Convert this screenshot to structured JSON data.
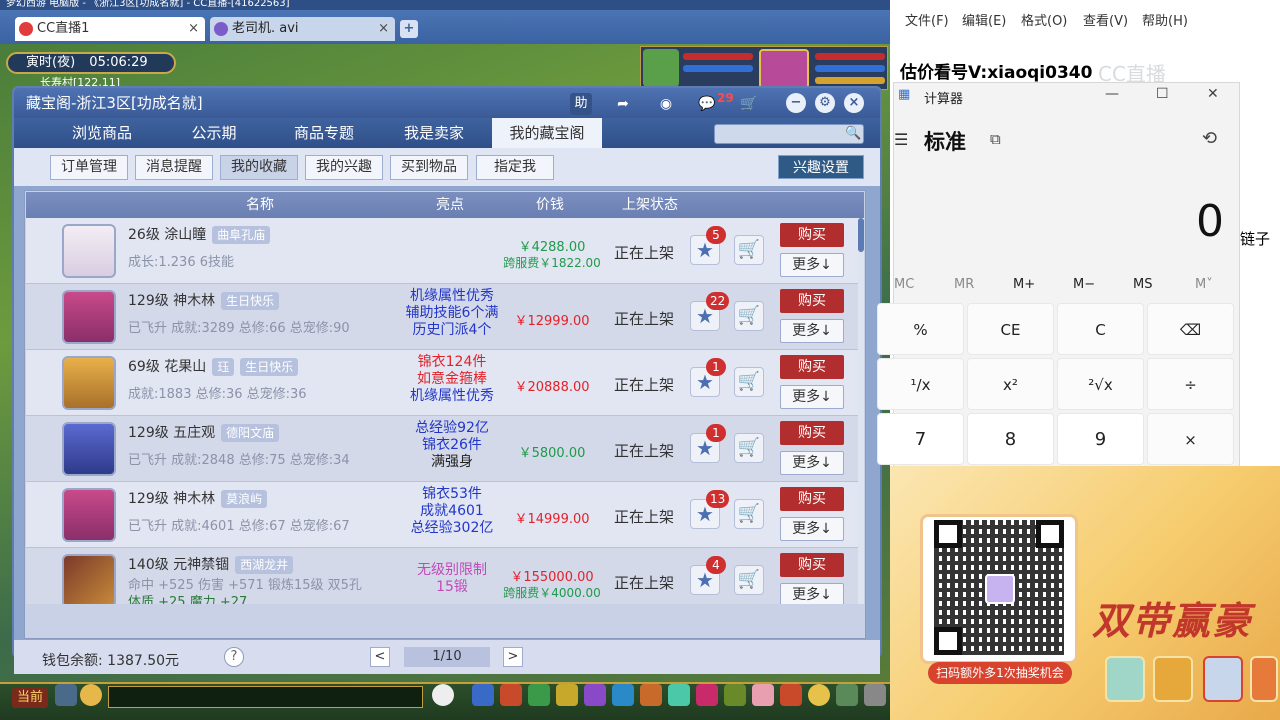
{
  "browser": {
    "top_text": "梦幻西游 电脑版 - 《浙江3区[功成名就] - CC直播-[41622563]",
    "tabs": [
      {
        "label": "CC直播1",
        "close": "×"
      },
      {
        "label": "老司机. avi",
        "close": "×"
      }
    ],
    "add_tab": "+"
  },
  "game": {
    "time_label": "寅时(夜)",
    "clock": "05:06:29",
    "location": "长寿村[122,11]"
  },
  "dialog": {
    "title": "藏宝阁-浙江3区[功成名就]",
    "help": "助",
    "message_count": "29",
    "nav_tabs": [
      "浏览商品",
      "公示期",
      "商品专题",
      "我是卖家",
      "我的藏宝阁"
    ],
    "sub_tabs": [
      "订单管理",
      "消息提醒",
      "我的收藏",
      "我的兴趣",
      "买到物品",
      "指定我"
    ],
    "interest_button": "兴趣设置",
    "columns": {
      "name": "名称",
      "highlight": "亮点",
      "price": "价钱",
      "status": "上架状态"
    },
    "rows": [
      {
        "level": "26级 涂山瞳",
        "server": "曲阜孔庙",
        "sub": "成长:1.236 6技能",
        "highlights": [],
        "price": "￥4288.00",
        "price2": "跨服费￥1822.00",
        "status": "正在上架",
        "fav": "5",
        "buy": "购买",
        "more": "更多↓"
      },
      {
        "level": "129级 神木林",
        "server": "生日快乐",
        "sub": "已飞升 成就:3289 总修:66 总宠修:90",
        "highlights": [
          "机缘属性优秀",
          "辅助技能6个满",
          "历史门派4个"
        ],
        "price": "￥12999.00",
        "price2": "",
        "status": "正在上架",
        "fav": "22",
        "buy": "购买",
        "more": "更多↓"
      },
      {
        "level": "69级 花果山",
        "tag": "珏",
        "server": "生日快乐",
        "sub": "成就:1883 总修:36 总宠修:36",
        "highlights": [
          "锦衣124件",
          "如意金箍棒",
          "机缘属性优秀"
        ],
        "price": "￥20888.00",
        "price2": "",
        "status": "正在上架",
        "fav": "1",
        "buy": "购买",
        "more": "更多↓"
      },
      {
        "level": "129级 五庄观",
        "server": "德阳文庙",
        "sub": "已飞升 成就:2848 总修:75 总宠修:34",
        "highlights": [
          "总经验92亿",
          "锦衣26件",
          "满强身"
        ],
        "price": "￥5800.00",
        "price2": "",
        "status": "正在上架",
        "fav": "1",
        "buy": "购买",
        "more": "更多↓"
      },
      {
        "level": "129级 神木林",
        "server": "莫浪屿",
        "sub": "已飞升 成就:4601 总修:67 总宠修:67",
        "highlights": [
          "锦衣53件",
          "成就4601",
          "总经验302亿"
        ],
        "price": "￥14999.00",
        "price2": "",
        "status": "正在上架",
        "fav": "13",
        "buy": "购买",
        "more": "更多↓"
      },
      {
        "level": "140级 元神禁锢",
        "server": "西湖龙井",
        "sub": "命中 +525 伤害 +571 锻炼15级 双5孔",
        "sub2": "体质 +25 魔力 +27",
        "highlights": [
          "无级别限制",
          "15锻"
        ],
        "price": "￥155000.00",
        "price2": "跨服费￥4000.00",
        "status": "正在上架",
        "fav": "4",
        "buy": "购买",
        "more": "更多↓"
      }
    ],
    "wallet": "钱包余额: 1387.50元",
    "help_q": "?",
    "page": "1/10",
    "prev": "<",
    "next": ">"
  },
  "bottom_bar": {
    "current": "当前"
  },
  "notepad": {
    "menu": [
      "文件(F)",
      "编辑(E)",
      "格式(O)",
      "查看(V)",
      "帮助(H)"
    ],
    "line1": "估价看号V:xiaoqi0340",
    "line2": "链子"
  },
  "watermark": "CC直播",
  "calculator": {
    "title": "计算器",
    "mode": "标准",
    "display": "0",
    "memory": [
      "MC",
      "MR",
      "M+",
      "M−",
      "MS",
      "M˅"
    ],
    "keys": [
      "%",
      "CE",
      "C",
      "⌫",
      "¹/x",
      "x²",
      "²√x",
      "÷",
      "7",
      "8",
      "9",
      "×"
    ]
  },
  "promo": {
    "qr_caption": "扫码额外多1次抽奖机会",
    "title": "双带赢豪"
  },
  "colors": {
    "accent": "#3a5a97",
    "buy": "#b22e2e",
    "price_red": "#e2222b",
    "price_green": "#1f9a4a",
    "highlight_blue": "#2236c8",
    "highlight_red": "#e2222b"
  }
}
